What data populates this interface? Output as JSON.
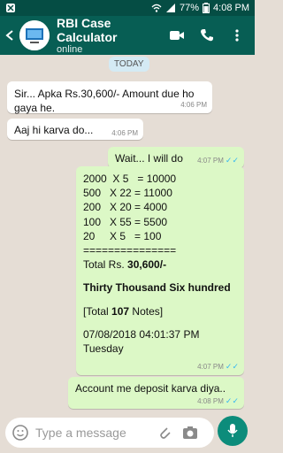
{
  "status": {
    "battery": "77%",
    "time": "4:08 PM"
  },
  "header": {
    "title": "RBI Case Calculator",
    "subtitle": "online"
  },
  "chat": {
    "day_label": "TODAY",
    "messages": [
      {
        "type": "in",
        "text": "Sir...  Apka Rs.30,600/- Amount due ho gaya he.",
        "time": "4:06 PM"
      },
      {
        "type": "in",
        "text": "Aaj hi karva do...",
        "time": "4:06 PM"
      },
      {
        "type": "out",
        "text": "Wait... I will do",
        "time": "4:07 PM"
      },
      {
        "type": "out",
        "lines": [
          "2000  X 5   = 10000",
          "500   X 22 = 11000",
          "200   X 20 = 4000",
          "100   X 55 = 5500",
          "20     X 5   = 100",
          "==============="
        ],
        "total_label": "Total Rs.",
        "total_value": "30,600/-",
        "total_words": "Thirty Thousand Six hundred",
        "notes_prefix": "[Total",
        "notes_count": "107",
        "notes_suffix": "Notes]",
        "datetime": "07/08/2018 04:01:37 PM",
        "weekday": "Tuesday",
        "time": "4:07 PM"
      },
      {
        "type": "out",
        "text": "Account me deposit karva diya..",
        "time": "4:08 PM"
      }
    ]
  },
  "composer": {
    "placeholder": "Type a message"
  }
}
